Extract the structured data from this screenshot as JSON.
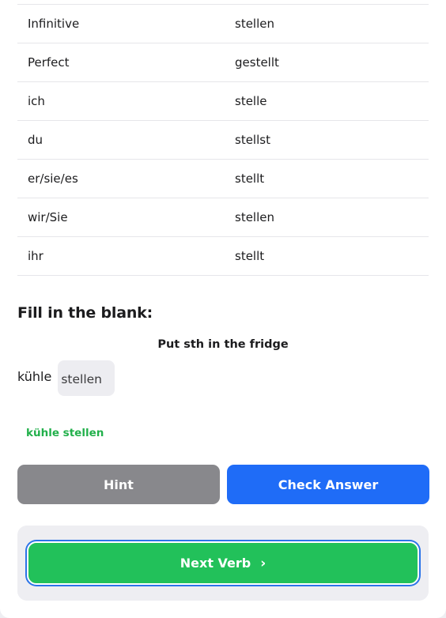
{
  "conjugation_table": [
    {
      "label": "Infinitive",
      "value": "stellen"
    },
    {
      "label": "Perfect",
      "value": "gestellt"
    },
    {
      "label": "ich",
      "value": "stelle"
    },
    {
      "label": "du",
      "value": "stellst"
    },
    {
      "label": "er/sie/es",
      "value": "stellt"
    },
    {
      "label": "wir/Sie",
      "value": "stellen"
    },
    {
      "label": "ihr",
      "value": "stellt"
    }
  ],
  "exercise": {
    "title": "Fill in the blank:",
    "prompt": "Put sth in the fridge",
    "prefix": "kühle",
    "input_value": "stellen",
    "feedback": "kühle stellen",
    "feedback_color": "#22b04b"
  },
  "buttons": {
    "hint": "Hint",
    "check": "Check Answer",
    "next": "Next Verb",
    "next_icon": "chevron-right-icon"
  },
  "colors": {
    "hint_bg": "#88888c",
    "check_bg": "#1f6cf7",
    "next_bg": "#22c15a",
    "focus_ring": "#2b74e8"
  }
}
